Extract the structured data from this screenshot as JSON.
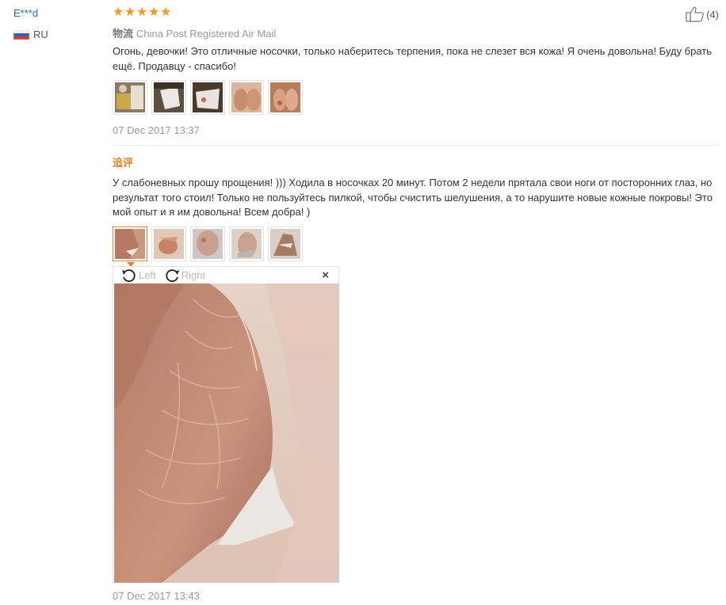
{
  "review": {
    "user": "E***d",
    "country": "RU",
    "rating": 5,
    "shipping_label": "物流",
    "shipping_method": "China Post Registered Air Mail",
    "helpful_count": "(4)",
    "text": "Огонь, девочки! Это отличные носочки, только наберитесь терпения, пока не слезет вся кожа! Я очень довольна! Буду брать ещё. Продавцу - спасибо!",
    "date": "07 Dec 2017 13:37",
    "photos": [
      "photo-1",
      "photo-2",
      "photo-3",
      "photo-4",
      "photo-5"
    ]
  },
  "additional": {
    "label": "追评",
    "text": "У слабоневных прошу прощения! ))) Ходила в носочках 20 минут. Потом 2 недели прятала свои ноги от посторонних глаз, но результат того стоил! Только не пользуйтесь пилкой, чтобы счистить шелушения, а то нарушите новые кожные покровы! Это мой опыт и я им довольна! Всем добра! )",
    "date": "07 Dec 2017 13:43",
    "photos": [
      "photo-1",
      "photo-2",
      "photo-3",
      "photo-4",
      "photo-5"
    ],
    "selected_photo": 1
  },
  "viewer": {
    "rotate_left": "Left",
    "rotate_right": "Right",
    "close": "×"
  },
  "colors": {
    "accent": "#e7822a",
    "star": "#f39a1e",
    "user": "#1a6fb4"
  }
}
